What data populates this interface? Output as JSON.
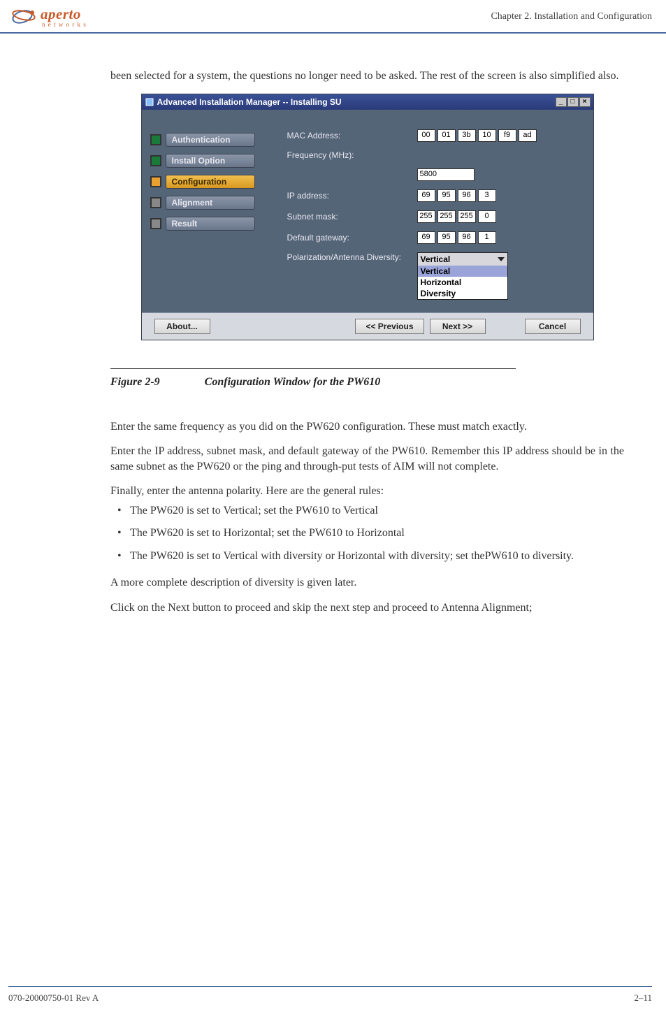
{
  "header": {
    "logo_text": "aperto",
    "logo_sub": "n e t w o r k s",
    "chapter": "Chapter 2.  Installation and Configuration"
  },
  "intro_para": "been selected for a system, the questions no longer need to be asked. The rest of the screen is also simplified also.",
  "window": {
    "title": "Advanced Installation Manager -- Installing SU",
    "steps": [
      {
        "label": "Authentication",
        "state": "done"
      },
      {
        "label": "Install Option",
        "state": "done"
      },
      {
        "label": "Configuration",
        "state": "active"
      },
      {
        "label": "Alignment",
        "state": "pending"
      },
      {
        "label": "Result",
        "state": "pending"
      }
    ],
    "form": {
      "mac_label": "MAC Address:",
      "mac": [
        "00",
        "01",
        "3b",
        "10",
        "f9",
        "ad"
      ],
      "freq_label": "Frequency (MHz):",
      "freq": "5800",
      "ip_label": "IP address:",
      "ip": [
        "69",
        "95",
        "96",
        "3"
      ],
      "subnet_label": "Subnet mask:",
      "subnet": [
        "255",
        "255",
        "255",
        "0"
      ],
      "gw_label": "Default gateway:",
      "gw": [
        "69",
        "95",
        "96",
        "1"
      ],
      "pol_label": "Polarization/Antenna Diversity:",
      "pol_selected": "Vertical",
      "pol_options": [
        "Vertical",
        "Horizontal",
        "Diversity"
      ]
    },
    "buttons": {
      "about": "About...",
      "prev": "<< Previous",
      "next": "Next >>",
      "cancel": "Cancel"
    }
  },
  "figure": {
    "num": "Figure 2-9",
    "title": "Configuration Window for the PW610"
  },
  "paras": {
    "p1": "Enter the same frequency as you did on the PW620 configuration. These must match exactly.",
    "p2": "Enter the IP address, subnet mask, and default gateway of the PW610. Remember this IP address should be in the same subnet as the PW620 or the ping and through-put tests of AIM will not complete.",
    "p3": "Finally, enter the antenna polarity. Here are the general rules:",
    "li1": "The PW620 is set to Vertical; set the PW610 to Vertical",
    "li2": "The PW620 is set to Horizontal; set the PW610 to Horizontal",
    "li3": "The PW620 is set to Vertical with diversity or Horizontal with diversity; set thePW610 to diversity.",
    "p4": "A more complete description of diversity is given later.",
    "p5": "Click on the Next button to proceed and skip the next step and proceed to Antenna Alignment;"
  },
  "footer": {
    "rev": "070-20000750-01 Rev A",
    "pagenum": "2–11"
  }
}
